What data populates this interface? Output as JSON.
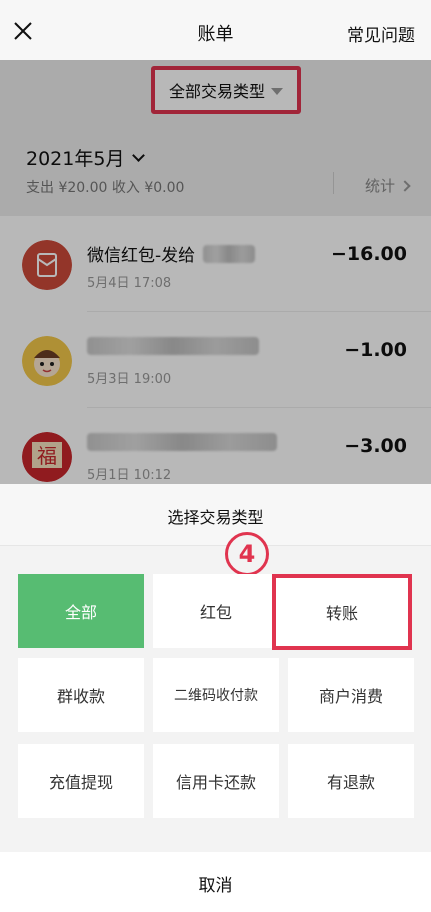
{
  "navbar": {
    "title": "账单",
    "faq_label": "常见问题"
  },
  "filter": {
    "label": "全部交易类型"
  },
  "month": {
    "label": "2021年5月",
    "summary": "支出 ¥20.00 收入 ¥0.00",
    "stats_label": "统计"
  },
  "transactions": [
    {
      "name": "微信红包-发给",
      "time": "5月4日 17:08",
      "amount": "−16.00"
    },
    {
      "name": "",
      "time": "5月3日 19:00",
      "amount": "−1.00"
    },
    {
      "name": "",
      "time": "5月1日 10:12",
      "amount": "−3.00"
    }
  ],
  "sheet": {
    "title": "选择交易类型",
    "step_badge": "4",
    "types": [
      "全部",
      "红包",
      "转账",
      "群收款",
      "二维码收付款",
      "商户消费",
      "充值提现",
      "信用卡还款",
      "有退款"
    ],
    "selected": "全部",
    "cancel_label": "取消"
  },
  "colors": {
    "accent_green": "#57bc72",
    "highlight_red": "#e0344f",
    "redpacket_red": "#cc4a3a"
  }
}
